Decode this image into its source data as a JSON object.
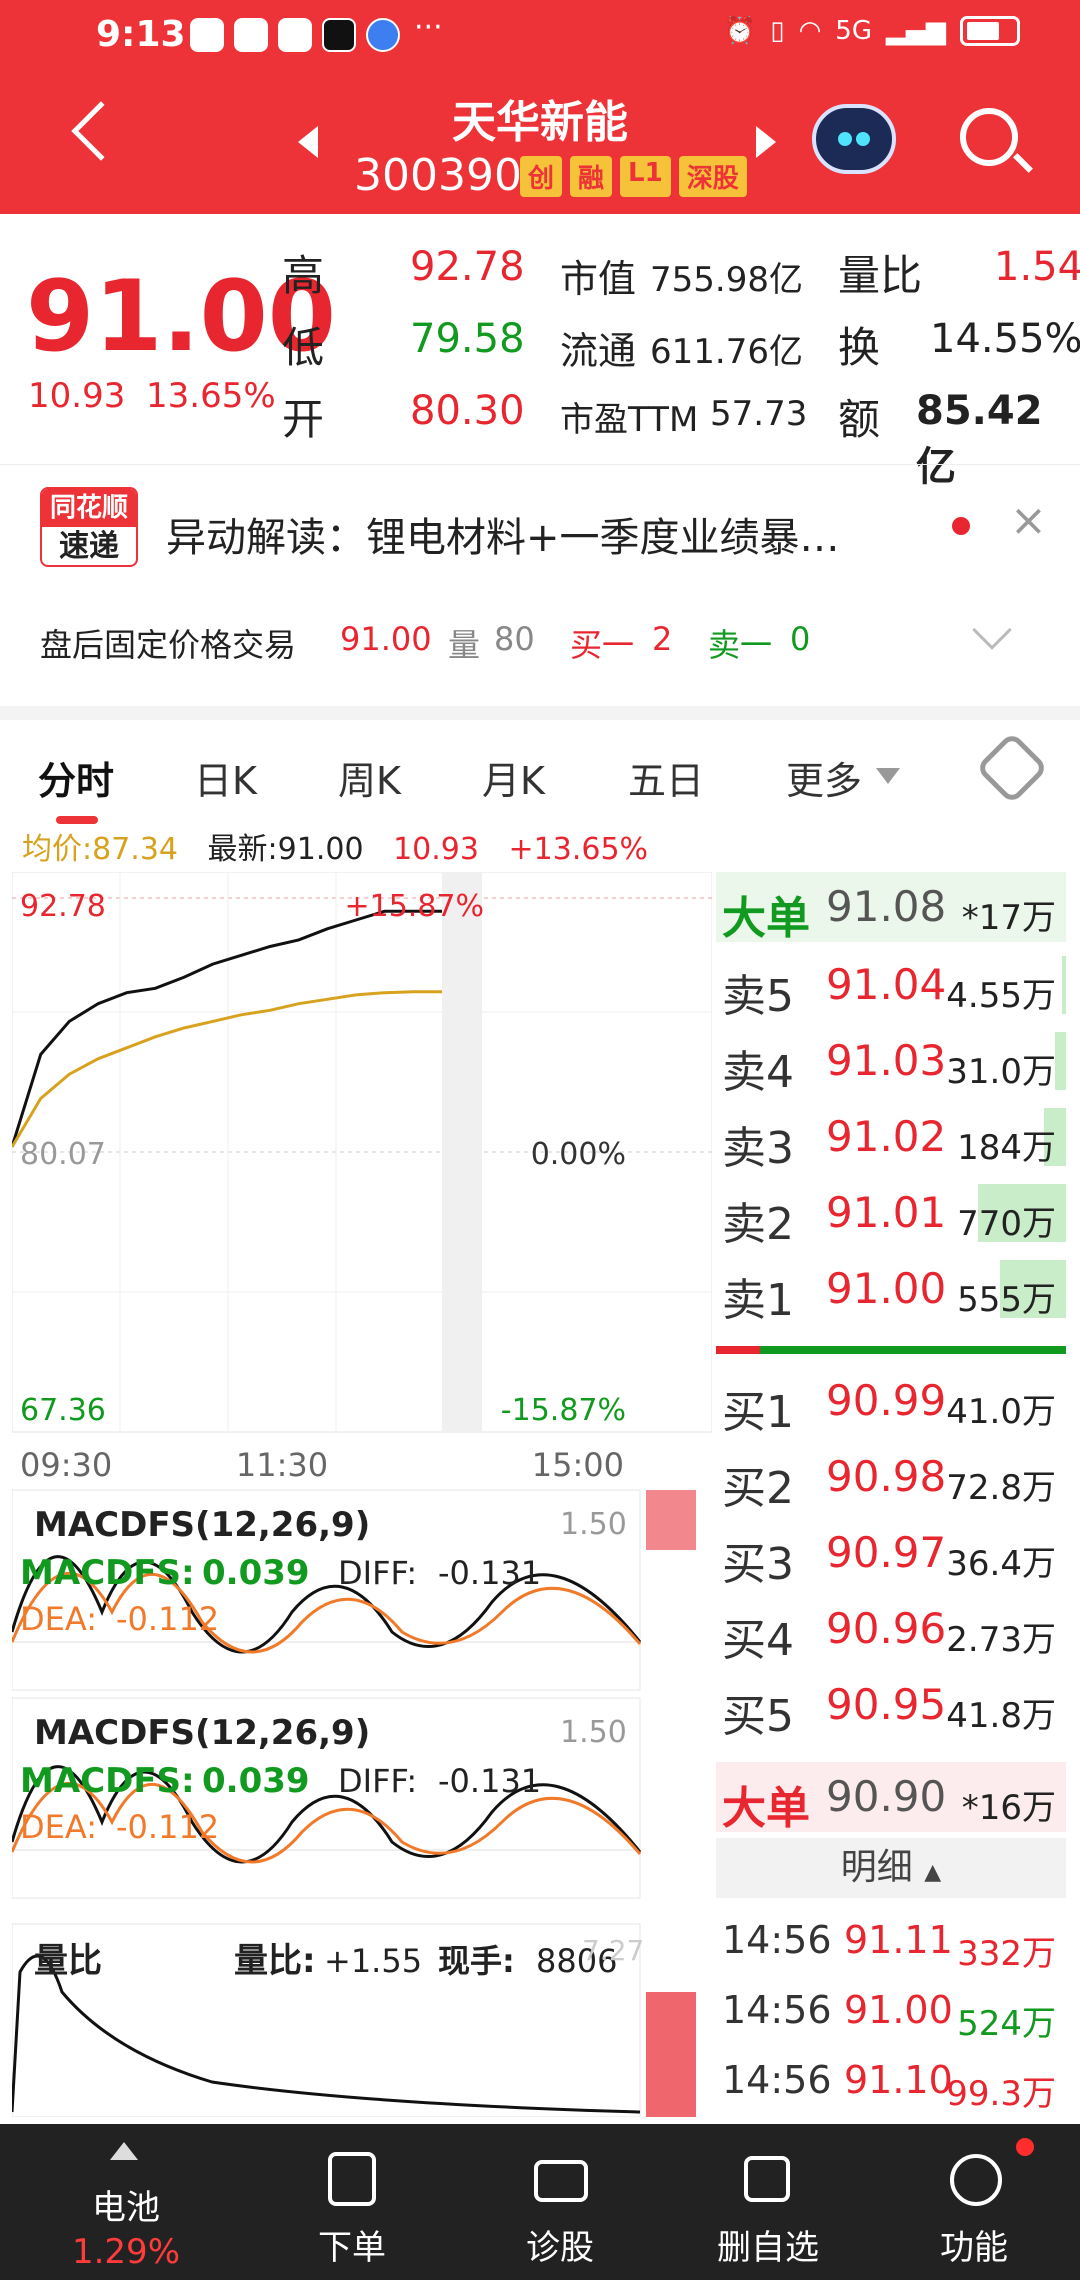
{
  "status": {
    "time": "9:13",
    "dots": "···",
    "network": "5G"
  },
  "header": {
    "title": "天华新能",
    "code": "300390",
    "tags": [
      "创",
      "融",
      "L1",
      "深股"
    ]
  },
  "quote": {
    "price": "91.00",
    "change": "10.93",
    "change_pct": "13.65%",
    "high_label": "高",
    "high": "92.78",
    "low_label": "低",
    "low": "79.58",
    "open_label": "开",
    "open": "80.30",
    "mcap_label": "市值",
    "mcap": "755.98亿",
    "float_label": "流通",
    "float": "611.76亿",
    "pe_label": "市盈TTM",
    "pe": "57.73",
    "vr_label": "量比",
    "vr": "1.54",
    "turn_label": "换",
    "turn": "14.55%",
    "amt_label": "额",
    "amt": "85.42亿"
  },
  "news": {
    "logo_top": "同花顺",
    "logo_bottom": "速递",
    "text": "异动解读：锂电材料+一季度业绩暴…"
  },
  "afterhours": {
    "label": "盘后固定价格交易",
    "price": "91.00",
    "vol_label": "量",
    "vol": "80",
    "buy_label": "买一",
    "buy": "2",
    "sell_label": "卖一",
    "sell": "0"
  },
  "tabs": [
    "分时",
    "日K",
    "周K",
    "月K",
    "五日",
    "更多"
  ],
  "infoline": {
    "avg_label": "均价:",
    "avg": "87.34",
    "last_label": "最新:",
    "last": "91.00",
    "chg": "10.93",
    "chg_pct": "+13.65%"
  },
  "chart_data": [
    {
      "type": "line",
      "title": "",
      "x_labels": [
        "09:30",
        "11:30",
        "15:00"
      ],
      "price_top": "92.78",
      "price_mid": "80.07",
      "price_bottom": "67.36",
      "pct_top": "+15.87%",
      "pct_mid": "0.00%",
      "pct_bottom": "-15.87%",
      "ylim": [
        67.36,
        92.78
      ],
      "series": [
        {
          "name": "",
          "values": [
            80.3,
            84.5,
            86.0,
            86.8,
            87.3,
            87.5,
            88.0,
            88.6,
            89.0,
            89.4,
            89.7,
            90.2,
            90.6,
            91.0,
            91.0,
            91.0
          ]
        },
        {
          "name": "均价",
          "values": [
            80.3,
            82.5,
            83.6,
            84.3,
            84.8,
            85.3,
            85.7,
            86.0,
            86.3,
            86.5,
            86.8,
            87.0,
            87.2,
            87.3,
            87.34,
            87.34
          ]
        }
      ]
    },
    {
      "type": "line",
      "title": "MACDFS(12,26,9)",
      "top_value": "1.50",
      "macd_label": "MACDFS:",
      "macd": "0.039",
      "diff_label": "DIFF:",
      "diff": "-0.131",
      "dea_label": "DEA:",
      "dea": "-0.112"
    },
    {
      "type": "line",
      "title": "MACDFS(12,26,9)",
      "top_value": "1.50",
      "macd_label": "MACDFS:",
      "macd": "0.039",
      "diff_label": "DIFF:",
      "diff": "-0.131",
      "dea_label": "DEA:",
      "dea": "-0.112"
    },
    {
      "type": "line",
      "title": "量比",
      "vr_label": "量比:",
      "vr": "+1.55",
      "hand_label": "现手:",
      "hand": "8806",
      "top_value": "7.27"
    }
  ],
  "orderbook": {
    "big_sell": {
      "label": "大单",
      "price": "91.08",
      "vol": "*17万"
    },
    "asks": [
      {
        "label": "卖5",
        "price": "91.04",
        "vol": "4.55万",
        "bar": 0.02
      },
      {
        "label": "卖4",
        "price": "91.03",
        "vol": "31.0万",
        "bar": 0.05
      },
      {
        "label": "卖3",
        "price": "91.02",
        "vol": "184万",
        "bar": 0.1
      },
      {
        "label": "卖2",
        "price": "91.01",
        "vol": "770万",
        "bar": 0.4
      },
      {
        "label": "卖1",
        "price": "91.00",
        "vol": "555万",
        "bar": 0.3
      }
    ],
    "bids": [
      {
        "label": "买1",
        "price": "90.99",
        "vol": "41.0万"
      },
      {
        "label": "买2",
        "price": "90.98",
        "vol": "72.8万"
      },
      {
        "label": "买3",
        "price": "90.97",
        "vol": "36.4万"
      },
      {
        "label": "买4",
        "price": "90.96",
        "vol": "2.73万"
      },
      {
        "label": "买5",
        "price": "90.95",
        "vol": "41.8万"
      }
    ],
    "big_buy": {
      "label": "大单",
      "price": "90.90",
      "vol": "*16万"
    },
    "detail_label": "明细",
    "ticks": [
      {
        "time": "14:56",
        "price": "91.11",
        "vol": "332万",
        "color": "red"
      },
      {
        "time": "14:56",
        "price": "91.00",
        "vol": "524万",
        "color": "green"
      },
      {
        "time": "14:56",
        "price": "91.10",
        "vol": "99.3万",
        "color": "red"
      }
    ]
  },
  "bottomnav": [
    {
      "label": "电池",
      "sub": "1.29%",
      "icon": "triangle-up-icon"
    },
    {
      "label": "下单",
      "icon": "document-icon"
    },
    {
      "label": "诊股",
      "icon": "medkit-icon"
    },
    {
      "label": "删自选",
      "icon": "minus-box-icon"
    },
    {
      "label": "功能",
      "icon": "menu-circle-icon"
    }
  ],
  "colors": {
    "red": "#e8262f",
    "green": "#119a1f",
    "header": "#ee3338",
    "avg_line": "#d7a21e"
  }
}
